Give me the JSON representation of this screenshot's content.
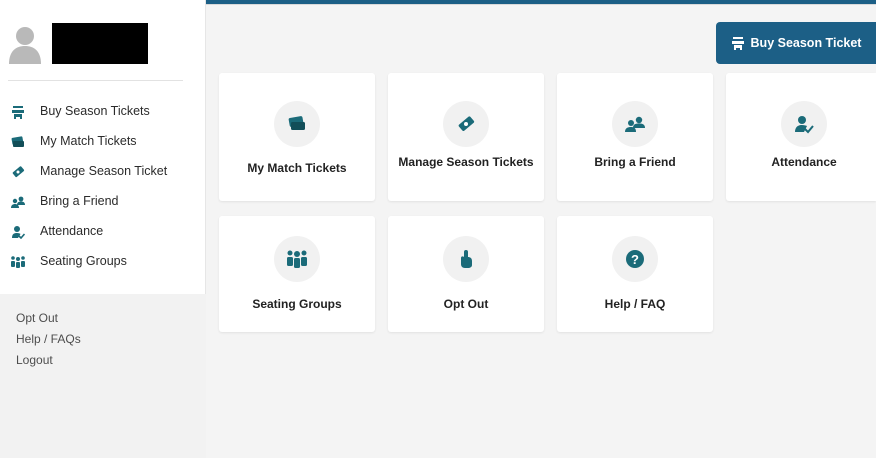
{
  "colors": {
    "brand": "#1c5f86",
    "icon": "#1b6b79",
    "muted": "#b5b5b5"
  },
  "sidebar": {
    "items": [
      {
        "label": "Buy Season Tickets",
        "icon": "ticket-bell-icon"
      },
      {
        "label": "My Match Tickets",
        "icon": "tickets-stack-icon"
      },
      {
        "label": "Manage Season Ticket",
        "icon": "ticket-star-icon"
      },
      {
        "label": "Bring a Friend",
        "icon": "users-icon"
      },
      {
        "label": "Attendance",
        "icon": "user-check-icon"
      },
      {
        "label": "Seating Groups",
        "icon": "group-icon"
      }
    ],
    "links": [
      "Opt Out",
      "Help / FAQs",
      "Logout"
    ]
  },
  "header": {
    "buy_button_label": "Buy Season Ticket",
    "buy_button_icon": "ticket-bell-icon"
  },
  "cards": [
    {
      "title": "My Match Tickets",
      "icon": "tickets-stack-icon"
    },
    {
      "title": "Manage Season Tickets",
      "icon": "ticket-star-icon"
    },
    {
      "title": "Bring a Friend",
      "icon": "users-icon"
    },
    {
      "title": "Attendance",
      "icon": "user-check-icon"
    },
    {
      "title": "Seating Groups",
      "icon": "group-icon"
    },
    {
      "title": "Opt Out",
      "icon": "hand-icon"
    },
    {
      "title": "Help / FAQ",
      "icon": "question-icon"
    }
  ]
}
